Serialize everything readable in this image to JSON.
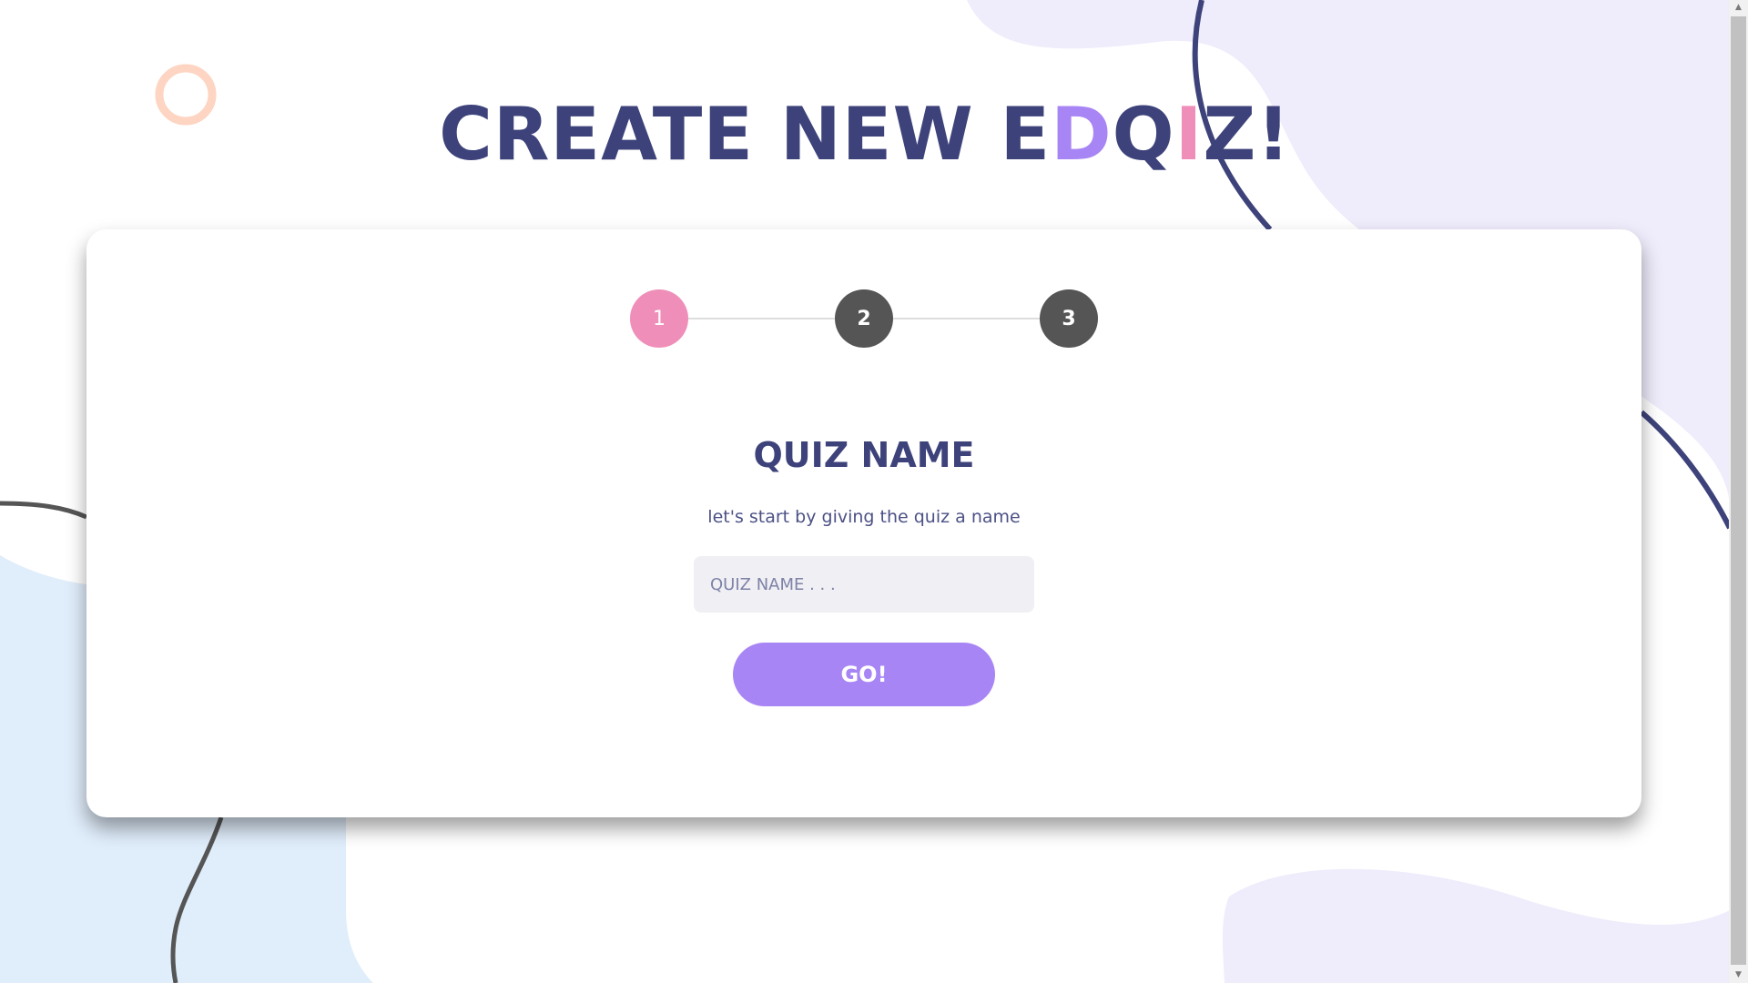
{
  "header": {
    "title_prefix": "CREATE NEW E",
    "title_d": "D",
    "title_q": "Q",
    "title_i": "I",
    "title_suffix": "Z!"
  },
  "stepper": {
    "steps": [
      {
        "label": "1",
        "state": "active"
      },
      {
        "label": "2",
        "state": "inactive"
      },
      {
        "label": "3",
        "state": "inactive"
      }
    ]
  },
  "form": {
    "section_title": "QUIZ NAME",
    "subtitle": "let's start by giving the quiz a name",
    "input_value": "",
    "input_placeholder": "QUIZ NAME . . .",
    "submit_label": "GO!"
  },
  "scrollbar": {
    "up_icon": "triangle-up",
    "down_icon": "triangle-down"
  },
  "colors": {
    "navy": "#3d437a",
    "purple": "#a885f5",
    "pink": "#ef8fb9",
    "dark_gray": "#555555",
    "peach": "#fdd5c2",
    "lavender_bg": "#efecfb",
    "light_blue_bg": "#e0edfb"
  }
}
